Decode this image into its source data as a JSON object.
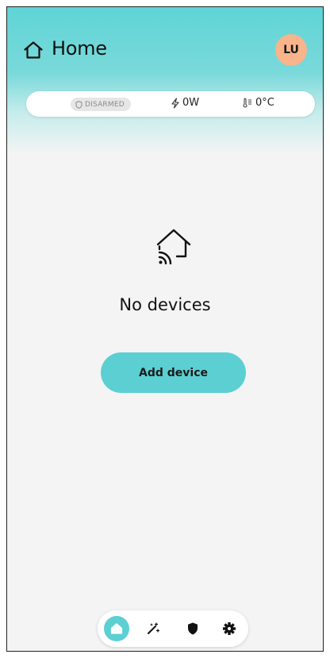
{
  "header": {
    "title": "Home",
    "home_icon": "home-icon",
    "avatar_initials": "LU"
  },
  "status": {
    "security_badge": "DISARMED",
    "security_icon": "shield-icon",
    "power_value": "0W",
    "power_icon": "lightning-icon",
    "temperature_value": "0°C",
    "temperature_icon": "thermometer-icon"
  },
  "empty_state": {
    "icon": "smart-home-wifi-icon",
    "message": "No devices"
  },
  "actions": {
    "add_device_label": "Add device"
  },
  "bottom_nav": {
    "items": [
      {
        "icon": "home-icon",
        "active": true
      },
      {
        "icon": "magic-wand-icon",
        "active": false
      },
      {
        "icon": "shield-icon",
        "active": false
      },
      {
        "icon": "gear-icon",
        "active": false
      }
    ]
  },
  "colors": {
    "accent": "#5ccfd3",
    "avatar_bg": "#f8b48a",
    "background": "#f4f4f4"
  }
}
